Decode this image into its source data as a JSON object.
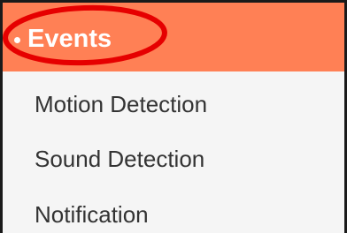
{
  "menu": {
    "header": {
      "label": "Events",
      "bullet": "•",
      "color": "#ff8055"
    },
    "highlight": {
      "shape": "ellipse",
      "color": "#e60000",
      "target": "Events"
    },
    "items": [
      {
        "label": "Motion Detection"
      },
      {
        "label": "Sound Detection"
      },
      {
        "label": "Notification"
      }
    ]
  }
}
